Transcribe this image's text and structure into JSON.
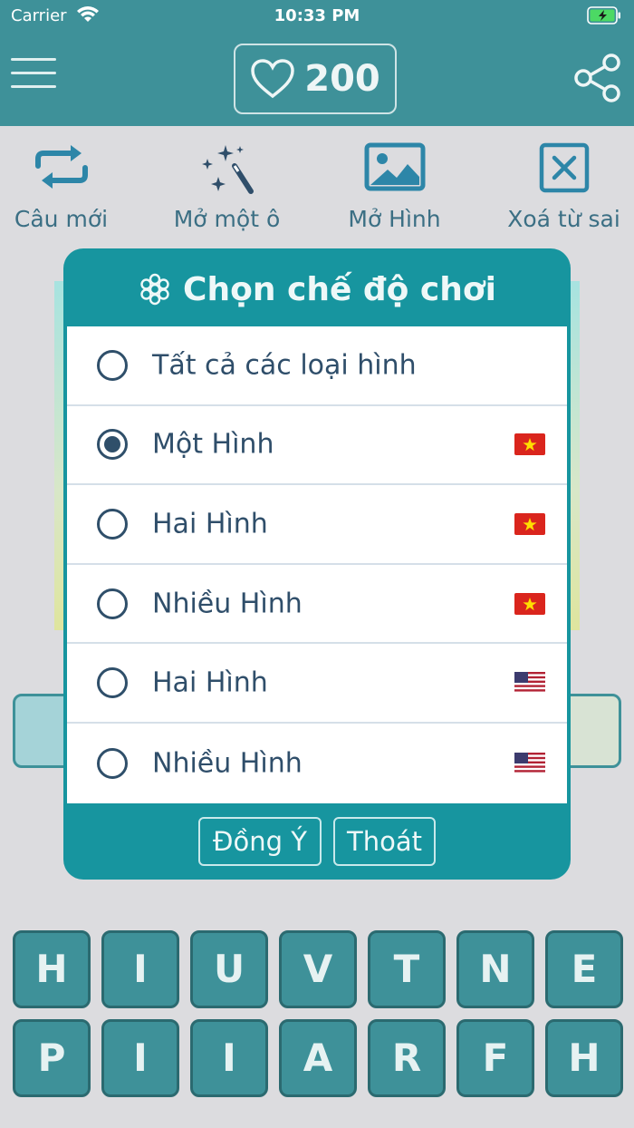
{
  "status_bar": {
    "carrier": "Carrier",
    "time": "10:33 PM"
  },
  "header": {
    "hearts": "200"
  },
  "tools": [
    {
      "label": "Câu mới",
      "icon": "repeat-arrows-icon"
    },
    {
      "label": "Mở một ô",
      "icon": "magic-wand-icon"
    },
    {
      "label": "Mở Hình",
      "icon": "image-icon"
    },
    {
      "label": "Xoá từ sai",
      "icon": "x-box-icon"
    }
  ],
  "dialog": {
    "title": "Chọn chế độ chơi",
    "options": [
      {
        "label": "Tất cả các loại hình",
        "selected": false,
        "flag": ""
      },
      {
        "label": "Một Hình",
        "selected": true,
        "flag": "vietnam-flag"
      },
      {
        "label": "Hai Hình",
        "selected": false,
        "flag": "vietnam-flag"
      },
      {
        "label": "Nhiều Hình",
        "selected": false,
        "flag": "vietnam-flag"
      },
      {
        "label": "Hai Hình",
        "selected": false,
        "flag": "us-flag"
      },
      {
        "label": "Nhiều Hình",
        "selected": false,
        "flag": "us-flag"
      }
    ],
    "ok_label": "Đồng Ý",
    "exit_label": "Thoát"
  },
  "letters": {
    "row1": [
      "H",
      "I",
      "U",
      "V",
      "T",
      "N",
      "E"
    ],
    "row2": [
      "P",
      "I",
      "I",
      "A",
      "R",
      "F",
      "H"
    ]
  },
  "colors": {
    "header_bg": "#3e9199",
    "dialog_bg": "#17959f",
    "text_dark": "#2f4e6a",
    "tool_label": "#3b6f84"
  }
}
